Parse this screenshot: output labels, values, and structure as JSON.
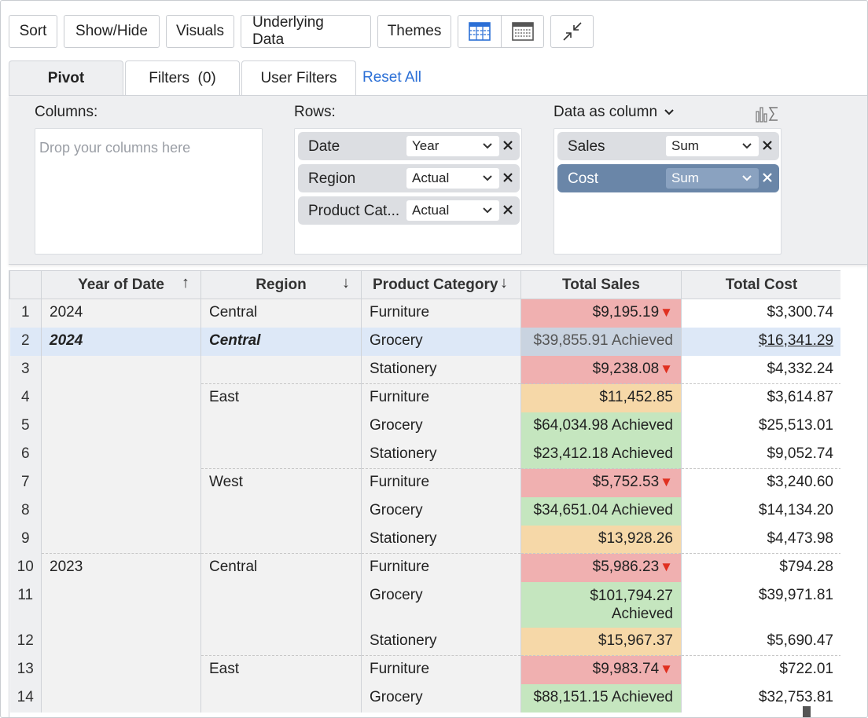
{
  "toolbar": {
    "buttons": [
      "Sort",
      "Show/Hide",
      "Visuals",
      "Underlying Data",
      "Themes"
    ],
    "icons": [
      "table-view-icon",
      "compact-table-icon",
      "collapse-icon"
    ],
    "accent": "#2b6fd6"
  },
  "tabs": {
    "items": [
      "Pivot",
      "Filters  (0)",
      "User Filters"
    ],
    "reset": "Reset All"
  },
  "pivot": {
    "columns_label": "Columns:",
    "columns_placeholder": "Drop your columns here",
    "rows_label": "Rows:",
    "rows": [
      {
        "field": "Date",
        "agg": "Year"
      },
      {
        "field": "Region",
        "agg": "Actual"
      },
      {
        "field": "Product Cat...",
        "agg": "Actual"
      }
    ],
    "data_label": "Data as column",
    "data": [
      {
        "field": "Sales",
        "agg": "Sum"
      },
      {
        "field": "Cost",
        "agg": "Sum"
      }
    ],
    "selected_chip_color": "#6a86a8"
  },
  "table": {
    "headers": [
      "Year of Date",
      "Region",
      "Product Category",
      "Total Sales",
      "Total Cost"
    ],
    "header_arrows": [
      "↑",
      "↓",
      "↓"
    ],
    "rows": [
      {
        "n": "1",
        "year": "2024",
        "region": "Central",
        "cat": "Furniture",
        "sales": "$9,195.19",
        "cost": "$3,300.74"
      },
      {
        "n": "2",
        "year": "2024",
        "region": "Central",
        "cat": "Grocery",
        "sales": "$39,855.91 Achieved",
        "cost": "$16,341.29"
      },
      {
        "n": "3",
        "year": "",
        "region": "",
        "cat": "Stationery",
        "sales": "$9,238.08",
        "cost": "$4,332.24"
      },
      {
        "n": "4",
        "year": "",
        "region": "East",
        "cat": "Furniture",
        "sales": "$11,452.85",
        "cost": "$3,614.87"
      },
      {
        "n": "5",
        "year": "",
        "region": "",
        "cat": "Grocery",
        "sales": "$64,034.98 Achieved",
        "cost": "$25,513.01"
      },
      {
        "n": "6",
        "year": "",
        "region": "",
        "cat": "Stationery",
        "sales": "$23,412.18 Achieved",
        "cost": "$9,052.74"
      },
      {
        "n": "7",
        "year": "",
        "region": "West",
        "cat": "Furniture",
        "sales": "$5,752.53",
        "cost": "$3,240.60"
      },
      {
        "n": "8",
        "year": "",
        "region": "",
        "cat": "Grocery",
        "sales": "$34,651.04 Achieved",
        "cost": "$14,134.20"
      },
      {
        "n": "9",
        "year": "",
        "region": "",
        "cat": "Stationery",
        "sales": "$13,928.26",
        "cost": "$4,473.98"
      },
      {
        "n": "10",
        "year": "2023",
        "region": "Central",
        "cat": "Furniture",
        "sales": "$5,986.23",
        "cost": "$794.28"
      },
      {
        "n": "11",
        "year": "",
        "region": "",
        "cat": "Grocery",
        "sales": "$101,794.27 Achieved",
        "cost": "$39,971.81"
      },
      {
        "n": "12",
        "year": "",
        "region": "",
        "cat": "Stationery",
        "sales": "$15,967.37",
        "cost": "$5,690.47"
      },
      {
        "n": "13",
        "year": "",
        "region": "East",
        "cat": "Furniture",
        "sales": "$9,983.74",
        "cost": "$722.01"
      },
      {
        "n": "14",
        "year": "",
        "region": "",
        "cat": "Grocery",
        "sales": "$88,151.15 Achieved",
        "cost": "$32,753.81"
      }
    ],
    "colors": {
      "red": "#f0b0b0",
      "orange": "#f6d8a8",
      "green": "#c5e6bf",
      "selected": "#dde8f7"
    }
  }
}
